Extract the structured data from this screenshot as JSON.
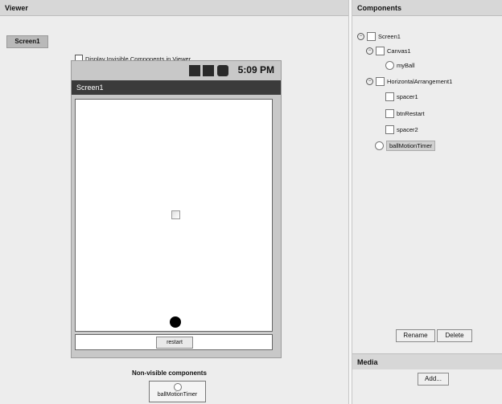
{
  "viewer": {
    "header": "Viewer",
    "screen_select": "Screen1",
    "display_invisible_label": "Display Invisible Components in Viewer",
    "phone": {
      "clock": "5:09 PM",
      "title": "Screen1",
      "restart_label": "restart"
    },
    "nonvisible_label": "Non-visible components",
    "nonvisible_items": [
      "ballMotionTimer"
    ]
  },
  "components": {
    "header": "Components",
    "tree": [
      {
        "label": "Screen1",
        "level": 0,
        "icon": "screen-icon"
      },
      {
        "label": "Canvas1",
        "level": 1,
        "icon": "canvas-icon"
      },
      {
        "label": "myBall",
        "level": 2,
        "icon": "ball-icon"
      },
      {
        "label": "HorizontalArrangement1",
        "level": 1,
        "icon": "arrangement-icon"
      },
      {
        "label": "spacer1",
        "level": 2,
        "icon": "label-icon"
      },
      {
        "label": "btnRestart",
        "level": 2,
        "icon": "button-icon"
      },
      {
        "label": "spacer2",
        "level": 2,
        "icon": "label-icon"
      },
      {
        "label": "ballMotionTimer",
        "level": 1,
        "icon": "clock-icon",
        "selected": true
      }
    ],
    "rename_label": "Rename",
    "delete_label": "Delete"
  },
  "media": {
    "header": "Media",
    "add_label": "Add..."
  }
}
